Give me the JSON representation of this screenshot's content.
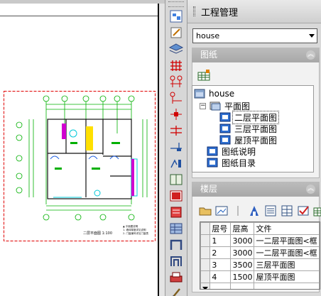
{
  "panel": {
    "title": "工程管理"
  },
  "project_combo": {
    "value": "house"
  },
  "drawings_section": {
    "header": "图纸",
    "tree": {
      "root": "house",
      "group1": "平面图",
      "children1": [
        "二层平面图",
        "三层平面图",
        "屋顶平面图"
      ],
      "item2": "图纸说明",
      "item3": "图纸目录"
    }
  },
  "floors_section": {
    "header": "楼层",
    "columns": [
      "层号",
      "层高",
      "文件"
    ],
    "rows": [
      {
        "no": "1",
        "height": "3000",
        "file": "一二层平面图<框"
      },
      {
        "no": "2",
        "height": "3000",
        "file": "一二层平面图<框"
      },
      {
        "no": "3",
        "height": "3500",
        "file": "三层平面图"
      },
      {
        "no": "4",
        "height": "1500",
        "file": "屋顶平面图"
      }
    ]
  },
  "drawing": {
    "caption": "二层平面图 1:100",
    "note_lines": [
      "▲ 平面图说明",
      "1. 墙体厚度详见说明",
      "2. 门窗编号详见门窗表"
    ]
  },
  "colors": {
    "panel_bg": "#d9d9d9",
    "section_header": "#b0b0b0",
    "cad_green": "#00b000",
    "cad_red": "#e00000",
    "cad_magenta": "#d000d0",
    "cad_cyan": "#00c8d8",
    "cad_blue": "#2060e0"
  }
}
